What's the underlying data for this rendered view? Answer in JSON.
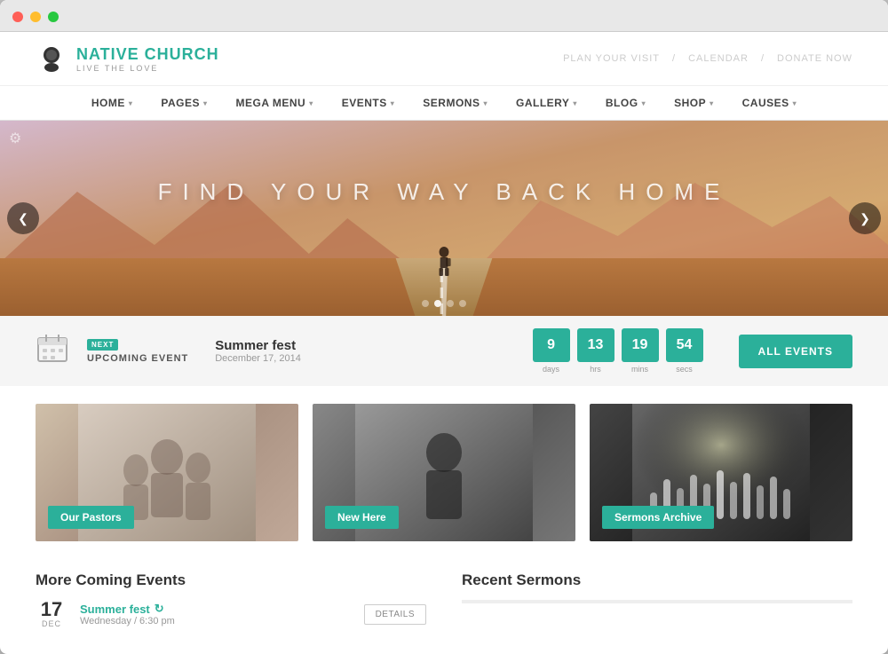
{
  "browser": {
    "dots": [
      "red",
      "yellow",
      "green"
    ]
  },
  "header": {
    "logo_main_plain": "NATIVE",
    "logo_main_accent": " CHURCH",
    "logo_sub": "LIVE THE LOVE",
    "top_links": [
      "PLAN YOUR VISIT",
      "/",
      "CALENDAR",
      "/",
      "DONATE NOW"
    ]
  },
  "nav": {
    "items": [
      {
        "label": "HOME",
        "has_arrow": true
      },
      {
        "label": "PAGES",
        "has_arrow": true
      },
      {
        "label": "MEGA MENU",
        "has_arrow": true
      },
      {
        "label": "EVENTS",
        "has_arrow": true
      },
      {
        "label": "SERMONS",
        "has_arrow": true
      },
      {
        "label": "GALLERY",
        "has_arrow": true
      },
      {
        "label": "BLOG",
        "has_arrow": true
      },
      {
        "label": "SHOP",
        "has_arrow": true
      },
      {
        "label": "CAUSES",
        "has_arrow": true
      }
    ]
  },
  "hero": {
    "text": "FIND YOUR WAY BACK HOME",
    "dots": [
      false,
      true,
      false,
      false
    ],
    "left_arrow": "❮",
    "right_arrow": "❯"
  },
  "event_bar": {
    "next_label": "NEXT",
    "upcoming_label": "UPCOMING EVENT",
    "event_title": "Summer fest",
    "event_date": "December 17, 2014",
    "countdown": [
      {
        "value": "9",
        "label": "days"
      },
      {
        "value": "13",
        "label": "hrs"
      },
      {
        "value": "19",
        "label": "mins"
      },
      {
        "value": "54",
        "label": "secs"
      }
    ],
    "all_events_label": "ALL EVENTS"
  },
  "cards": [
    {
      "label": "Our Pastors",
      "img_type": "pastors"
    },
    {
      "label": "New Here",
      "img_type": "new"
    },
    {
      "label": "Sermons Archive",
      "img_type": "sermons"
    }
  ],
  "more_events": {
    "section_title": "More Coming Events",
    "event_date_num": "17",
    "event_date_month": "DEC",
    "event_title": "Summer fest",
    "event_refresh_icon": "↻",
    "event_sub": "Wednesday / 6:30 pm",
    "details_label": "DETAILS"
  },
  "recent_sermons": {
    "section_title": "Recent Sermons"
  }
}
